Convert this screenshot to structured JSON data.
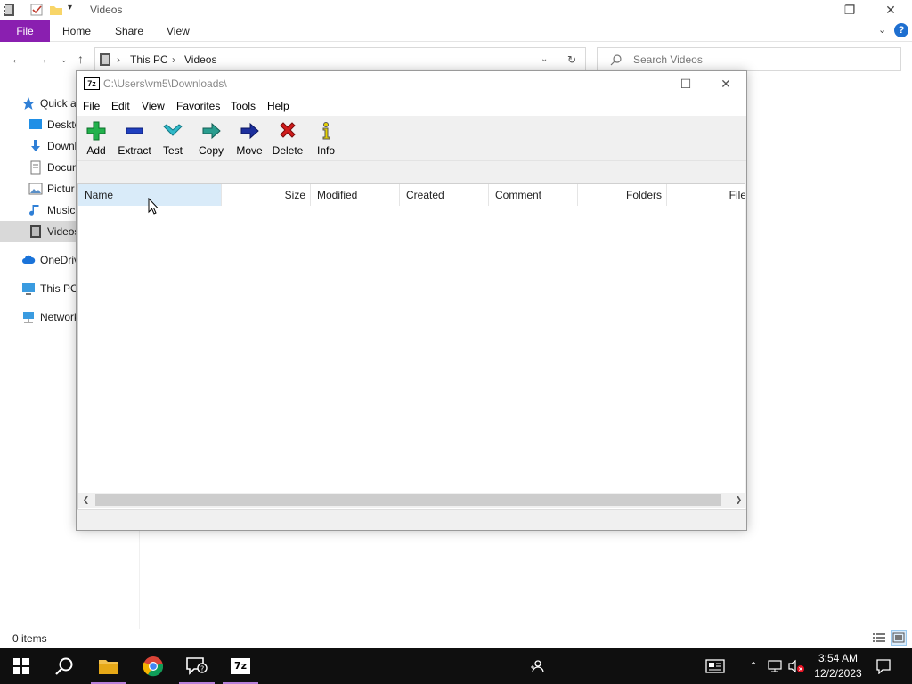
{
  "explorer": {
    "title": "Videos",
    "ribbon": {
      "file_label": "File",
      "tabs": [
        "Home",
        "Share",
        "View"
      ]
    },
    "address": {
      "crumbs": [
        "This PC",
        "Videos"
      ]
    },
    "search": {
      "placeholder": "Search Videos"
    },
    "nav_items": [
      {
        "label": "Quick a",
        "icon": "star-icon"
      },
      {
        "label": "Deskto",
        "icon": "desktop-icon"
      },
      {
        "label": "Downl",
        "icon": "download-icon"
      },
      {
        "label": "Docum",
        "icon": "document-icon"
      },
      {
        "label": "Pictur",
        "icon": "picture-icon"
      },
      {
        "label": "Music",
        "icon": "music-icon"
      },
      {
        "label": "Videos",
        "icon": "video-icon",
        "selected": true
      },
      {
        "label": "OneDriv",
        "icon": "cloud-icon"
      },
      {
        "label": "This PC",
        "icon": "computer-icon"
      },
      {
        "label": "Network",
        "icon": "network-icon"
      }
    ],
    "status": {
      "items_count": "0 items"
    },
    "accent_color": "#8a1fb0"
  },
  "zip": {
    "title_path": "C:\\Users\\vm5\\Downloads\\",
    "logo_text": "7z",
    "menu": [
      "File",
      "Edit",
      "View",
      "Favorites",
      "Tools",
      "Help"
    ],
    "toolbar": [
      {
        "label": "Add",
        "icon": "add-icon",
        "color": "#22b14c"
      },
      {
        "label": "Extract",
        "icon": "extract-icon",
        "color": "#1f3fbf"
      },
      {
        "label": "Test",
        "icon": "test-icon",
        "color": "#2fb8c8"
      },
      {
        "label": "Copy",
        "icon": "copy-icon",
        "color": "#2a9d8f"
      },
      {
        "label": "Move",
        "icon": "move-icon",
        "color": "#1c2f9c"
      },
      {
        "label": "Delete",
        "icon": "delete-icon",
        "color": "#d11c1c"
      },
      {
        "label": "Info",
        "icon": "info-icon",
        "color": "#c9b800"
      }
    ],
    "columns": [
      "Name",
      "Size",
      "Modified",
      "Created",
      "Comment",
      "Folders",
      "File"
    ]
  },
  "taskbar": {
    "apps": [
      "start-icon",
      "search-icon",
      "file-explorer-icon",
      "chrome-icon",
      "feedback-hub-icon",
      "7zip-icon"
    ],
    "time": "3:54 AM",
    "date": "12/2/2023"
  }
}
